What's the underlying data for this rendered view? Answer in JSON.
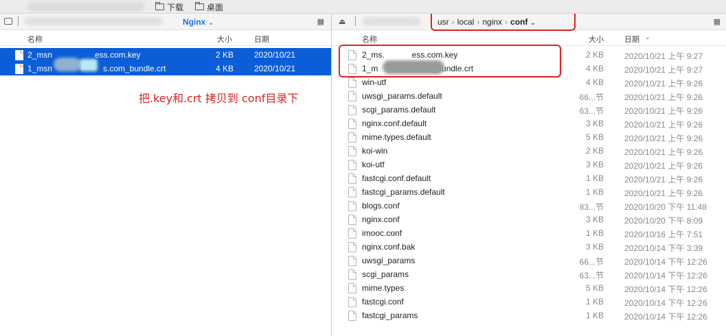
{
  "favorites": [
    {
      "label": "下载"
    },
    {
      "label": "桌面"
    }
  ],
  "left": {
    "breadcrumb_current": "Nginx",
    "columns": {
      "name": "名称",
      "size": "大小",
      "date": "日期"
    },
    "files": [
      {
        "name_start": "2_msn",
        "name_end": "ess.com.key",
        "size": "2 KB",
        "date": "2020/10/21"
      },
      {
        "name_start": "1_msn",
        "name_end": "s.com_bundle.crt",
        "size": "4 KB",
        "date": "2020/10/21"
      }
    ],
    "annotation": "把.key和.crt 拷贝到 conf目录下"
  },
  "right": {
    "path": [
      "usr",
      "local",
      "nginx",
      "conf"
    ],
    "columns": {
      "name": "名称",
      "size": "大小",
      "date": "日期"
    },
    "files": [
      {
        "name": "2_ms.            ess.com.key",
        "size": "2 KB",
        "date": "2020/10/21 上午 9:27"
      },
      {
        "name": "1_m                .com_bundle.crt",
        "size": "4 KB",
        "date": "2020/10/21 上午 9:27"
      },
      {
        "name": "win-utf",
        "size": "4 KB",
        "date": "2020/10/21 上午 9:26"
      },
      {
        "name": "uwsgi_params.default",
        "size": "66...节",
        "date": "2020/10/21 上午 9:26"
      },
      {
        "name": "scgi_params.default",
        "size": "63...节",
        "date": "2020/10/21 上午 9:26"
      },
      {
        "name": "nginx.conf.default",
        "size": "3 KB",
        "date": "2020/10/21 上午 9:26"
      },
      {
        "name": "mime.types.default",
        "size": "5 KB",
        "date": "2020/10/21 上午 9:26"
      },
      {
        "name": "koi-win",
        "size": "2 KB",
        "date": "2020/10/21 上午 9:26"
      },
      {
        "name": "koi-utf",
        "size": "3 KB",
        "date": "2020/10/21 上午 9:26"
      },
      {
        "name": "fastcgi.conf.default",
        "size": "1 KB",
        "date": "2020/10/21 上午 9:26"
      },
      {
        "name": "fastcgi_params.default",
        "size": "1 KB",
        "date": "2020/10/21 上午 9:26"
      },
      {
        "name": "blogs.conf",
        "size": "83...节",
        "date": "2020/10/20 下午 11:48"
      },
      {
        "name": "nginx.conf",
        "size": "3 KB",
        "date": "2020/10/20 下午 8:09"
      },
      {
        "name": "imooc.conf",
        "size": "1 KB",
        "date": "2020/10/16 上午 7:51"
      },
      {
        "name": "nginx.conf.bak",
        "size": "3 KB",
        "date": "2020/10/14 下午 3:39"
      },
      {
        "name": "uwsgi_params",
        "size": "66...节",
        "date": "2020/10/14 下午 12:26"
      },
      {
        "name": "scgi_params",
        "size": "63...节",
        "date": "2020/10/14 下午 12:26"
      },
      {
        "name": "mime.types",
        "size": "5 KB",
        "date": "2020/10/14 下午 12:26"
      },
      {
        "name": "fastcgi.conf",
        "size": "1 KB",
        "date": "2020/10/14 下午 12:26"
      },
      {
        "name": "fastcgi_params",
        "size": "1 KB",
        "date": "2020/10/14 下午 12:26"
      }
    ]
  },
  "colors": {
    "selection": "#0b5dd8",
    "annotation": "#e02020",
    "breadcrumb": "#1a73e8"
  },
  "icons": [
    "folder-icon",
    "drive-icon",
    "eject-icon",
    "grid-view-icon",
    "chevron-down-icon",
    "chevron-right-icon",
    "file-icon"
  ]
}
